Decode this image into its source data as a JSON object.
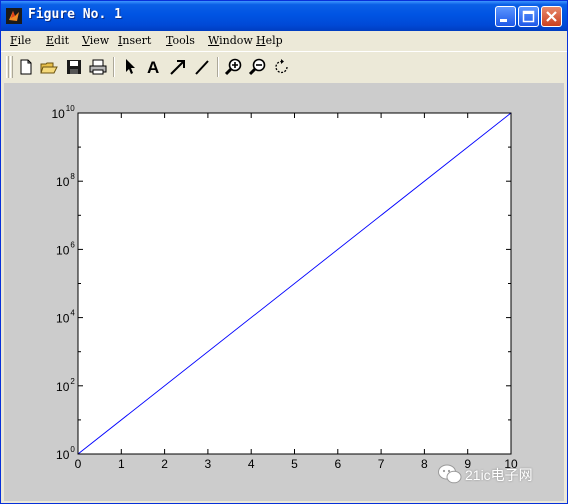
{
  "window": {
    "title": "Figure No. 1"
  },
  "menubar": {
    "items": [
      {
        "label": "File",
        "accel": "F",
        "rest": "ile"
      },
      {
        "label": "Edit",
        "accel": "E",
        "rest": "dit"
      },
      {
        "label": "View",
        "accel": "V",
        "rest": "iew"
      },
      {
        "label": "Insert",
        "accel": "I",
        "rest": "nsert"
      },
      {
        "label": "Tools",
        "accel": "T",
        "rest": "ools"
      },
      {
        "label": "Window",
        "accel": "W",
        "rest": "indow"
      },
      {
        "label": "Help",
        "accel": "H",
        "rest": "elp"
      }
    ]
  },
  "toolbar": {
    "buttons": [
      "new-file-icon",
      "open-folder-icon",
      "save-icon",
      "print-icon",
      "select-arrow-icon",
      "insert-text-icon",
      "insert-arrow-icon",
      "insert-line-icon",
      "zoom-in-icon",
      "zoom-out-icon",
      "rotate-icon"
    ],
    "text_tool_label": "A"
  },
  "chart_data": {
    "type": "line",
    "yscale": "log",
    "xlim": [
      0,
      10
    ],
    "ylim_exponents": [
      0,
      10
    ],
    "x_ticks": [
      0,
      1,
      2,
      3,
      4,
      5,
      6,
      7,
      8,
      9,
      10
    ],
    "x_tick_labels": [
      "0",
      "1",
      "2",
      "3",
      "4",
      "5",
      "6",
      "7",
      "8",
      "9",
      "10"
    ],
    "y_tick_exponents": [
      0,
      2,
      4,
      6,
      8,
      10
    ],
    "y_tick_labels": [
      {
        "base": "10",
        "exp": "0"
      },
      {
        "base": "10",
        "exp": "2"
      },
      {
        "base": "10",
        "exp": "4"
      },
      {
        "base": "10",
        "exp": "6"
      },
      {
        "base": "10",
        "exp": "8"
      },
      {
        "base": "10",
        "exp": "10"
      }
    ],
    "series": [
      {
        "x": [
          0,
          10
        ],
        "y": [
          1,
          10000000000
        ],
        "color": "#0000ff"
      }
    ],
    "grid": false,
    "title": "",
    "xlabel": "",
    "ylabel": ""
  },
  "watermark": {
    "text": "21ic电子网"
  },
  "colors": {
    "figure_bg": "#cccccc",
    "axes_bg": "#ffffff",
    "line": "#0000ff",
    "titlebar": "#0054e3"
  }
}
